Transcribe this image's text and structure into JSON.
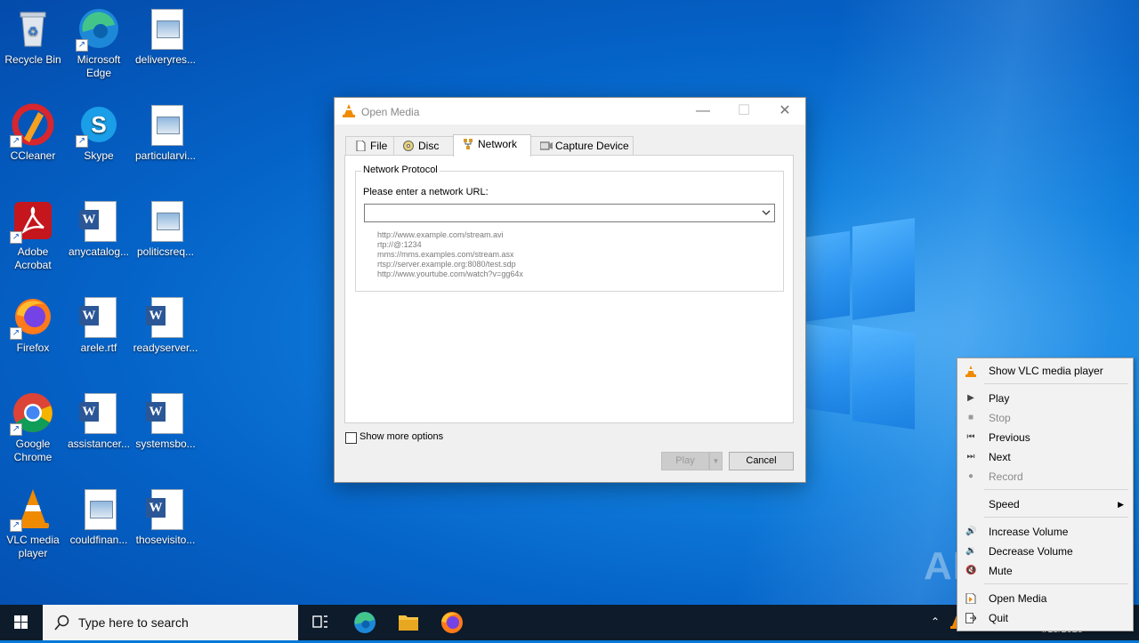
{
  "desktop": {
    "icons": [
      {
        "label": "Recycle Bin"
      },
      {
        "label": "Microsoft Edge"
      },
      {
        "label": "deliveryres..."
      },
      {
        "label": "CCleaner"
      },
      {
        "label": "Skype"
      },
      {
        "label": "particularvi..."
      },
      {
        "label": "Adobe Acrobat"
      },
      {
        "label": "anycatalog..."
      },
      {
        "label": "politicsreq..."
      },
      {
        "label": "Firefox"
      },
      {
        "label": "arele.rtf"
      },
      {
        "label": "readyserver..."
      },
      {
        "label": "Google Chrome"
      },
      {
        "label": "assistancer..."
      },
      {
        "label": "systemsbo..."
      },
      {
        "label": "VLC media player"
      },
      {
        "label": "couldfinan..."
      },
      {
        "label": "thosevisito..."
      }
    ]
  },
  "dialog": {
    "title": "Open Media",
    "tabs": [
      {
        "label": "File",
        "icon": "file-icon"
      },
      {
        "label": "Disc",
        "icon": "disc-icon"
      },
      {
        "label": "Network",
        "icon": "network-icon",
        "active": true
      },
      {
        "label": "Capture Device",
        "icon": "capture-device-icon"
      }
    ],
    "group_title": "Network Protocol",
    "url_label": "Please enter a network URL:",
    "url_value": "",
    "examples": [
      "http://www.example.com/stream.avi",
      "rtp://@:1234",
      "mms://mms.examples.com/stream.asx",
      "rtsp://server.example.org:8080/test.sdp",
      "http://www.yourtube.com/watch?v=gg64x"
    ],
    "show_more_label": "Show more options",
    "play_label": "Play",
    "cancel_label": "Cancel"
  },
  "context_menu": {
    "items": [
      {
        "label": "Show VLC media player",
        "icon": "vlc-cone-icon",
        "enabled": true
      },
      {
        "label": "Play",
        "icon": "play-icon",
        "enabled": true
      },
      {
        "label": "Stop",
        "icon": "stop-icon",
        "enabled": false
      },
      {
        "label": "Previous",
        "icon": "previous-icon",
        "enabled": true
      },
      {
        "label": "Next",
        "icon": "next-icon",
        "enabled": true
      },
      {
        "label": "Record",
        "icon": "record-icon",
        "enabled": false
      },
      {
        "label": "Speed",
        "icon": "",
        "enabled": true,
        "submenu": true
      },
      {
        "label": "Increase Volume",
        "icon": "volume-up-icon",
        "enabled": true
      },
      {
        "label": "Decrease Volume",
        "icon": "volume-down-icon",
        "enabled": true
      },
      {
        "label": "Mute",
        "icon": "mute-icon",
        "enabled": true
      },
      {
        "label": "Open Media",
        "icon": "open-media-icon",
        "enabled": true
      },
      {
        "label": "Quit",
        "icon": "quit-icon",
        "enabled": true
      }
    ]
  },
  "taskbar": {
    "search_placeholder": "Type here to search",
    "date": "4/15/2025"
  },
  "watermark": "ANY.RUN",
  "colors": {
    "desktop_blue": "#0a78d7",
    "taskbar": "#0d1b2a",
    "vlc_orange": "#f08a00"
  }
}
